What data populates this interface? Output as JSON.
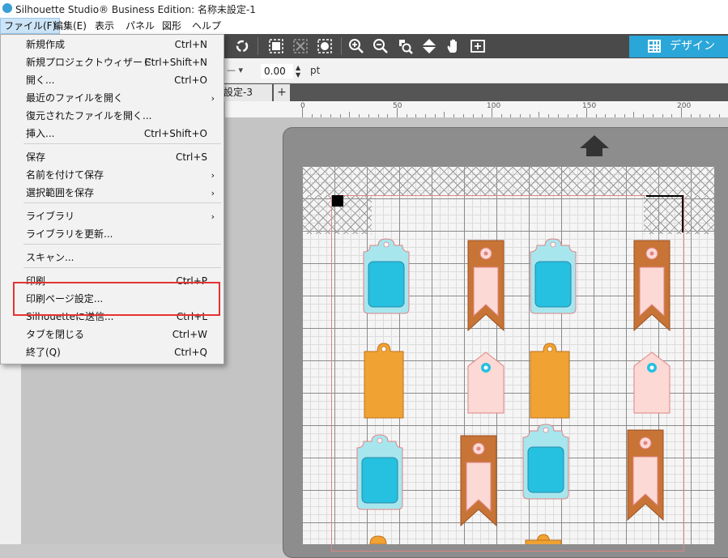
{
  "window": {
    "title": "Silhouette Studio® Business Edition: 名称未設定-1"
  },
  "menubar": {
    "items": [
      "ファイル(F)",
      "編集(E)",
      "表示",
      "パネル",
      "図形",
      "ヘルプ"
    ]
  },
  "design_button": {
    "label": "デザイン"
  },
  "properties": {
    "value": "0.00",
    "unit": "pt"
  },
  "doc_tab": {
    "label": "設定-3",
    "add": "+"
  },
  "ruler": {
    "labels": [
      "0",
      "50",
      "100",
      "150",
      "200"
    ]
  },
  "file_menu": {
    "items": [
      {
        "label": "新規作成",
        "shortcut": "Ctrl+N"
      },
      {
        "label": "新規プロジェクトウィザード",
        "shortcut": "Ctrl+Shift+N"
      },
      {
        "label": "開く...",
        "shortcut": "Ctrl+O"
      },
      {
        "label": "最近のファイルを開く",
        "shortcut": ""
      },
      {
        "label": "復元されたファイルを開く...",
        "shortcut": ""
      },
      {
        "label": "挿入...",
        "shortcut": "Ctrl+Shift+O"
      },
      {
        "label": "保存",
        "shortcut": "Ctrl+S"
      },
      {
        "label": "名前を付けて保存",
        "shortcut": ""
      },
      {
        "label": "選択範囲を保存",
        "shortcut": ""
      },
      {
        "label": "ライブラリ",
        "shortcut": ""
      },
      {
        "label": "ライブラリを更新...",
        "shortcut": ""
      },
      {
        "label": "スキャン...",
        "shortcut": ""
      },
      {
        "label": "印刷",
        "shortcut": "Ctrl+P"
      },
      {
        "label": "印刷ページ設定...",
        "shortcut": ""
      },
      {
        "label": "Silhouetteに送信...",
        "shortcut": "Ctrl+L"
      },
      {
        "label": "タブを閉じる",
        "shortcut": "Ctrl+W"
      },
      {
        "label": "終了(Q)",
        "shortcut": "Ctrl+Q"
      }
    ],
    "submenu_arrow": "›",
    "highlighted": "印刷ページ設定..."
  },
  "icons": [
    "app-icon",
    "rotate-icon",
    "group-icon",
    "ungroup-icon",
    "effects-icon",
    "zoom-in-icon",
    "zoom-out-icon",
    "zoom-selection-icon",
    "move-up-icon",
    "pan-hand-icon",
    "fit-page-icon",
    "design-grid-icon",
    "move-arrow-up-icon"
  ],
  "colors": {
    "toolbar": "#4a4a4a",
    "accent": "#2ba6d9",
    "highlight_box": "#e53333",
    "tag_blue": "#26c0e0",
    "tag_light": "#a8e6ee",
    "tag_orange": "#f0a332",
    "tag_pink": "#fcd9d4",
    "bookmark_brown": "#c87436"
  }
}
